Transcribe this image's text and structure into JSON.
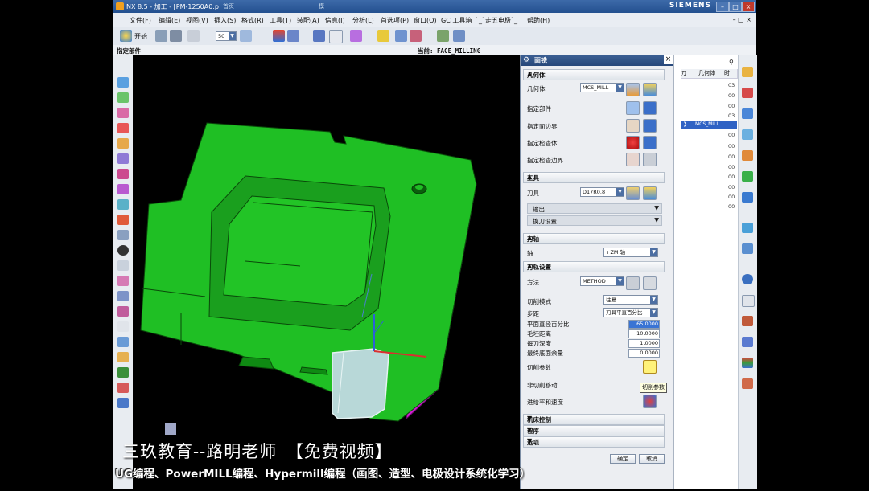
{
  "window": {
    "title": "NX 8.5 - 加工 - [PM-1250A0.p",
    "tab_icons": [
      "首页",
      "模"
    ],
    "brand": "SIEMENS"
  },
  "menu": {
    "items": [
      "文件(F)",
      "编辑(E)",
      "视图(V)",
      "插入(S)",
      "格式(R)",
      "工具(T)",
      "装配(A)",
      "信息(I)",
      "分析(L)",
      "首选项(P)",
      "窗口(O)",
      "GC 工具箱",
      "`_`走五电极`_",
      "帮助(H)"
    ]
  },
  "toolbar": {
    "start_label": "开始",
    "zoom_value": "50"
  },
  "cue": {
    "left": "指定部件",
    "current": "当前: FACE_MILLING"
  },
  "dialog": {
    "title": "面铣",
    "geometry": {
      "header": "几何体",
      "geometry_label": "几何体",
      "geometry_value": "MCS_MILL",
      "specify_part": "指定部件",
      "specify_face_boundary": "指定面边界",
      "specify_check": "指定检查体",
      "specify_check_boundary": "指定检查边界"
    },
    "tool": {
      "header": "工具",
      "tool_label": "刀具",
      "tool_value": "D17R0.8",
      "output": "输出",
      "tool_change": "换刀设置"
    },
    "axis": {
      "header": "刀轴",
      "axis_label": "轴",
      "axis_value": "+ZM 轴"
    },
    "path": {
      "header": "刀轨设置",
      "method_label": "方法",
      "method_value": "METHOD",
      "cut_pattern_label": "切削模式",
      "cut_pattern_value": "往复",
      "stepover_label": "步距",
      "stepover_value": "刀具平直百分比",
      "flat_pct_label": "平面直径百分比",
      "flat_pct_value": "65.0000",
      "gap_label": "毛坯距离",
      "gap_value": "10.0000",
      "depth_label": "每刀深度",
      "depth_value": "1.0000",
      "floor_label": "最终底面余量",
      "floor_value": "0.0000",
      "cut_params_label": "切削参数",
      "noncut_label": "非切削移动",
      "feeds_label": "进给率和速度"
    },
    "machine_control": "机床控制",
    "program": "程序",
    "options": "选项",
    "ok": "确定",
    "cancel": "取消",
    "tooltip": "切削参数"
  },
  "navigator": {
    "col1": "刀",
    "col2": "几何体",
    "col3": "时",
    "rows": [
      "03",
      "00",
      "00",
      "03",
      "00",
      "00",
      "00",
      "00",
      "00",
      "00",
      "00",
      "00"
    ],
    "selected": "MCS_MILL"
  },
  "captions": {
    "line1": "三玖教育--路明老师　【免费视频】",
    "line2": "UG编程、PowerMILL编程、Hypermill编程（画图、造型、电极设计系统化学习）"
  },
  "colors": {
    "part": "#1fbf24",
    "side": "#d51cd5",
    "stock": "#b8d8d8"
  }
}
